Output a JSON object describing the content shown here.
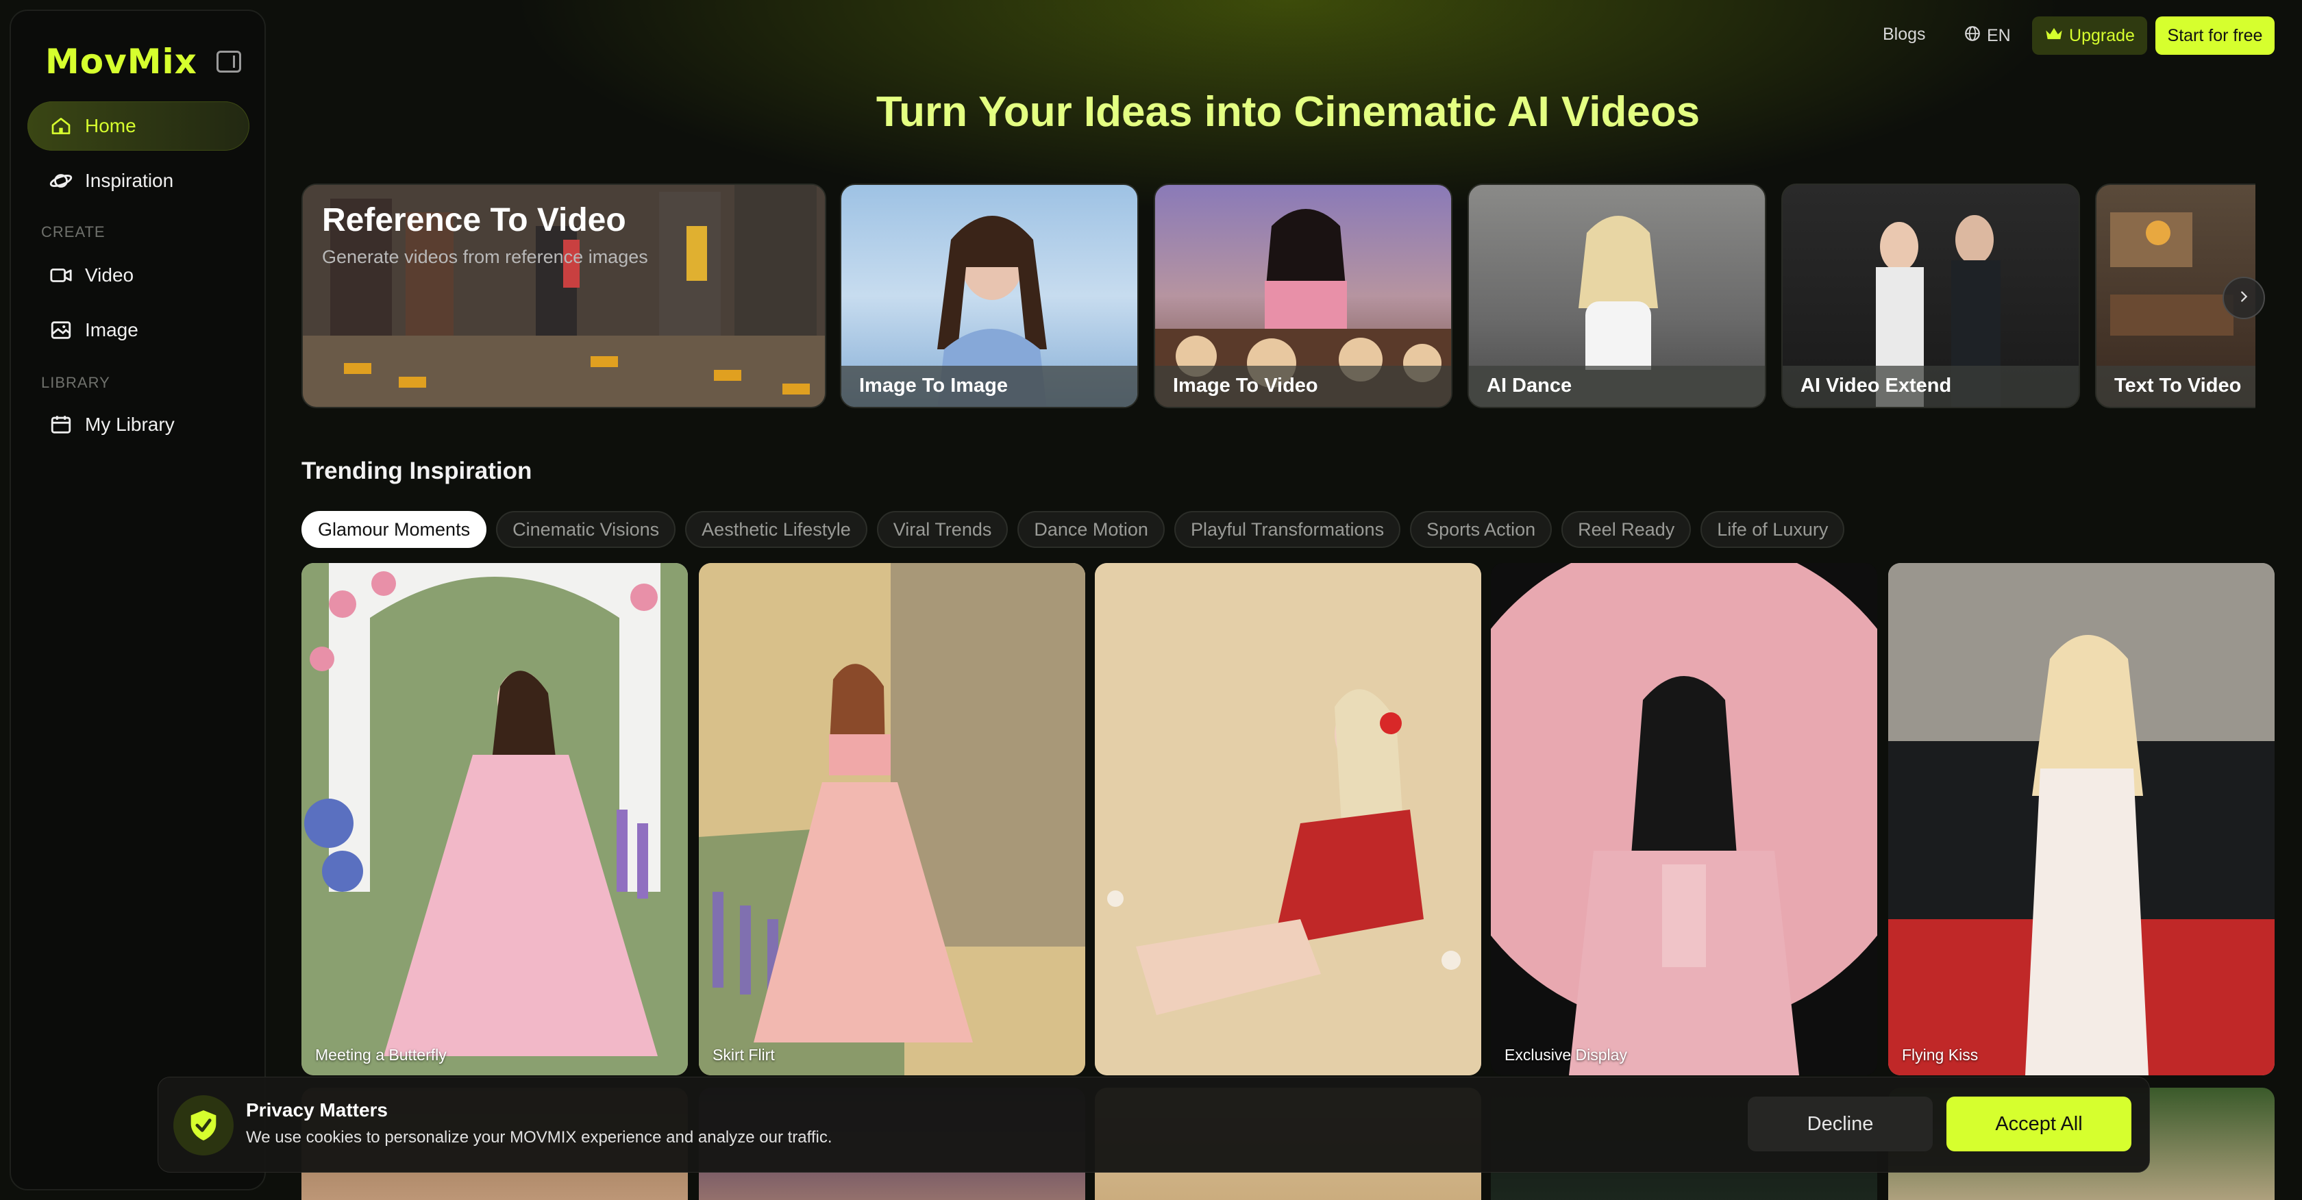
{
  "brand": {
    "logo": "MovMix",
    "accent": "#d6ff2e",
    "title_color": "#e4ff82"
  },
  "sidebar": {
    "collapse_icon": "sidebar-toggle-icon",
    "items": [
      {
        "label": "Home",
        "icon": "home-icon",
        "active": true
      },
      {
        "label": "Inspiration",
        "icon": "planet-icon"
      }
    ],
    "create_label": "CREATE",
    "create_items": [
      {
        "label": "Video",
        "icon": "video-camera-icon"
      },
      {
        "label": "Image",
        "icon": "image-icon"
      }
    ],
    "library_label": "LIBRARY",
    "library_items": [
      {
        "label": "My Library",
        "icon": "folder-icon"
      }
    ]
  },
  "topbar": {
    "blogs": "Blogs",
    "language": "EN",
    "upgrade": "Upgrade",
    "start": "Start for free"
  },
  "hero": {
    "title": "Turn Your Ideas into Cinematic AI Videos"
  },
  "features": {
    "reference": {
      "title": "Reference To Video",
      "subtitle": "Generate videos from reference images"
    },
    "cards": [
      {
        "label": "Image To Image"
      },
      {
        "label": "Image To Video"
      },
      {
        "label": "AI Dance"
      },
      {
        "label": "AI Video Extend"
      },
      {
        "label": "Text To Video"
      }
    ]
  },
  "trending": {
    "title": "Trending Inspiration",
    "chips": [
      "Glamour Moments",
      "Cinematic Visions",
      "Aesthetic Lifestyle",
      "Viral Trends",
      "Dance Motion",
      "Playful Transformations",
      "Sports Action",
      "Reel Ready",
      "Life of Luxury"
    ],
    "active_chip": "Glamour Moments",
    "gallery": [
      {
        "caption": "Meeting a Butterfly"
      },
      {
        "caption": "Skirt Flirt"
      },
      {
        "caption": ""
      },
      {
        "caption": "Exclusive Display"
      },
      {
        "caption": "Flying Kiss"
      }
    ]
  },
  "cookie": {
    "title": "Privacy Matters",
    "text": "We use cookies to personalize your MOVMIX experience and analyze our traffic.",
    "decline": "Decline",
    "accept": "Accept All"
  }
}
